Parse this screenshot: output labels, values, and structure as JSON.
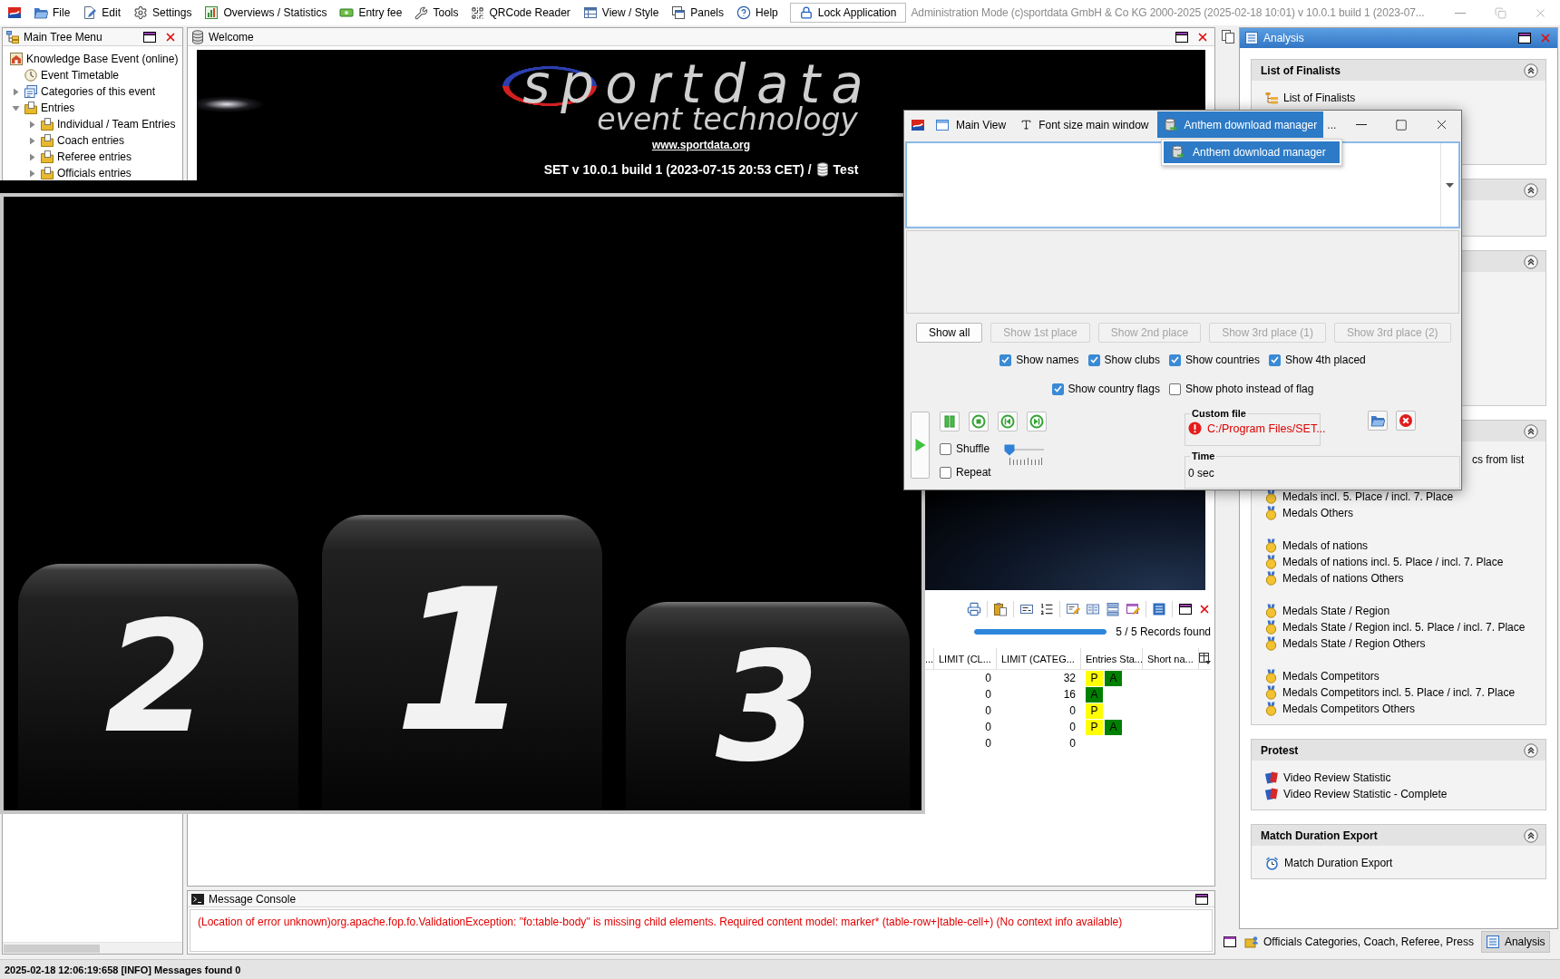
{
  "menu_bar": {
    "items": [
      {
        "label": "File",
        "kind": "file"
      },
      {
        "label": "Edit",
        "kind": "edit"
      },
      {
        "label": "Settings",
        "kind": "settings"
      },
      {
        "label": "Overviews / Statistics",
        "kind": "stats"
      },
      {
        "label": "Entry fee",
        "kind": "fee"
      },
      {
        "label": "Tools",
        "kind": "tools"
      },
      {
        "label": "QRCode Reader",
        "kind": "qrcode"
      },
      {
        "label": "View / Style",
        "kind": "view"
      },
      {
        "label": "Panels",
        "kind": "panels"
      },
      {
        "label": "Help",
        "kind": "help"
      }
    ],
    "lock_button": "Lock Application",
    "info": "Administration Mode (c)sportdata GmbH & Co KG 2000-2025 (2025-02-18 10:01) v 10.0.1 build 1 (2023-07..."
  },
  "tree_panel": {
    "title": "Main Tree Menu",
    "nodes": [
      {
        "label": "Knowledge Base Event (online)",
        "kind": "house",
        "children": [
          {
            "label": "Event Timetable",
            "kind": "clock"
          },
          {
            "label": "Categories of this event",
            "kind": "documents",
            "expanded": false
          },
          {
            "label": "Entries",
            "kind": "folder",
            "expanded": true,
            "children": [
              {
                "label": "Individual / Team Entries",
                "kind": "folder",
                "expanded": false
              },
              {
                "label": "Coach entries",
                "kind": "folder",
                "expanded": false
              },
              {
                "label": "Referee entries",
                "kind": "folder",
                "expanded": false
              },
              {
                "label": "Officials entries",
                "kind": "folder",
                "expanded": false
              }
            ]
          }
        ]
      }
    ]
  },
  "welcome_panel": {
    "title": "Welcome",
    "logo": {
      "wordmark": "sportdata",
      "tagline": "event technology"
    },
    "link": "www.sportdata.org",
    "version": "SET v 10.0.1 build 1 (2023-07-15 20:53 CET) /",
    "database": "Test"
  },
  "anthem_dialog": {
    "tabs": [
      {
        "label": "Main View",
        "kind": "window",
        "selected": false
      },
      {
        "label": "Font size main window",
        "kind": "font",
        "selected": false
      },
      {
        "label": "Anthem download manager",
        "kind": "anthem",
        "selected": true
      }
    ],
    "overflow": "...",
    "menu": [
      {
        "label": "Anthem download manager",
        "selected": true
      }
    ],
    "buttons": [
      {
        "label": "Show all",
        "disabled": false
      },
      {
        "label": "Show 1st place",
        "disabled": true
      },
      {
        "label": "Show 2nd place",
        "disabled": true
      },
      {
        "label": "Show 3rd place (1)",
        "disabled": true
      },
      {
        "label": "Show 3rd place (2)",
        "disabled": true
      }
    ],
    "option_rows": [
      [
        {
          "label": "Show names",
          "checked": true
        },
        {
          "label": "Show clubs",
          "checked": true
        },
        {
          "label": "Show countries",
          "checked": true
        },
        {
          "label": "Show 4th placed",
          "checked": true
        }
      ],
      [
        {
          "label": "Show country flags",
          "checked": true
        },
        {
          "label": "Show photo instead of flag",
          "checked": false
        }
      ]
    ],
    "shuffle": {
      "label": "Shuffle",
      "checked": false
    },
    "repeat": {
      "label": "Repeat",
      "checked": false
    },
    "volume": {
      "level": 0
    },
    "custom_file": {
      "title": "Custom file",
      "path": "C:/Program Files/SET..."
    },
    "time": {
      "title": "Time",
      "value": "0 sec"
    }
  },
  "analysis_panel": {
    "title": "Analysis",
    "sections": [
      {
        "title": "List of Finalists",
        "expanded": true,
        "groups": [
          [
            {
              "label": "List of Finalists",
              "kind": "hierarchy"
            }
          ]
        ]
      },
      {
        "expanded": true
      },
      {
        "expanded": true
      },
      {
        "expanded": true,
        "groups": [
          [
            {
              "label": "cs from list",
              "kind": "clipped"
            },
            {
              "label": "Medals incl. 5. Place / incl. 7. Place",
              "kind": "medal"
            },
            {
              "label": "Medals Others",
              "kind": "medal"
            }
          ],
          [
            {
              "label": "Medals of nations",
              "kind": "medal"
            },
            {
              "label": "Medals of nations incl. 5. Place / incl. 7. Place",
              "kind": "medal"
            },
            {
              "label": "Medals of nations Others",
              "kind": "medal"
            }
          ],
          [
            {
              "label": "Medals State / Region",
              "kind": "medal"
            },
            {
              "label": "Medals State / Region incl. 5. Place / incl. 7. Place",
              "kind": "medal"
            },
            {
              "label": "Medals State / Region Others",
              "kind": "medal"
            }
          ],
          [
            {
              "label": "Medals Competitors",
              "kind": "medal"
            },
            {
              "label": "Medals Competitors incl. 5. Place / incl. 7. Place",
              "kind": "medal"
            },
            {
              "label": "Medals Competitors Others",
              "kind": "medal"
            }
          ]
        ]
      },
      {
        "title": "Protest",
        "expanded": true,
        "groups": [
          [
            {
              "label": "Video Review Statistic",
              "kind": "cards"
            },
            {
              "label": "Video Review Statistic - Complete",
              "kind": "cards"
            }
          ]
        ]
      },
      {
        "title": "Match Duration Export",
        "expanded": true,
        "groups": [
          [
            {
              "label": "Match Duration Export",
              "kind": "alarm"
            }
          ]
        ]
      }
    ],
    "tabs": [
      {
        "label": "Officials Categories, Coach, Referee, Press",
        "selected": false
      },
      {
        "label": "Analysis",
        "selected": true
      }
    ]
  },
  "podium_window": {
    "places": [
      "2",
      "1",
      "3"
    ]
  },
  "records_panel": {
    "progress": {
      "level": 1
    },
    "status": "5 / 5 Records found",
    "columns": [
      "...",
      "LIMIT (CL...",
      "LIMIT (CATEG...",
      "Entries Sta...",
      "Short na..."
    ],
    "rows": [
      {
        "limit_cl": "0",
        "limit_categ": "32",
        "entries_status": [
          {
            "label": "P",
            "color": "#ffff00"
          },
          {
            "label": "A",
            "color": "#008000"
          }
        ]
      },
      {
        "limit_cl": "0",
        "limit_categ": "16",
        "entries_status": [
          {
            "label": "A",
            "color": "#008000"
          }
        ]
      },
      {
        "limit_cl": "0",
        "limit_categ": "0",
        "entries_status": [
          {
            "label": "P",
            "color": "#ffff00"
          }
        ]
      },
      {
        "limit_cl": "0",
        "limit_categ": "0",
        "entries_status": [
          {
            "label": "P",
            "color": "#ffff00"
          },
          {
            "label": "A",
            "color": "#008000"
          }
        ]
      },
      {
        "limit_cl": "0",
        "limit_categ": "0"
      }
    ]
  },
  "message_console": {
    "title": "Message Console",
    "messages": [
      {
        "kind": "error",
        "text": "(Location of error unknown)org.apache.fop.fo.ValidationException: \"fo:table-body\" is missing child elements. Required content model: marker* (table-row+|table-cell+) (No context info available)"
      }
    ]
  },
  "status_bar": {
    "text": "2025-02-18 12:06:19:658 [INFO] Messages found 0"
  }
}
